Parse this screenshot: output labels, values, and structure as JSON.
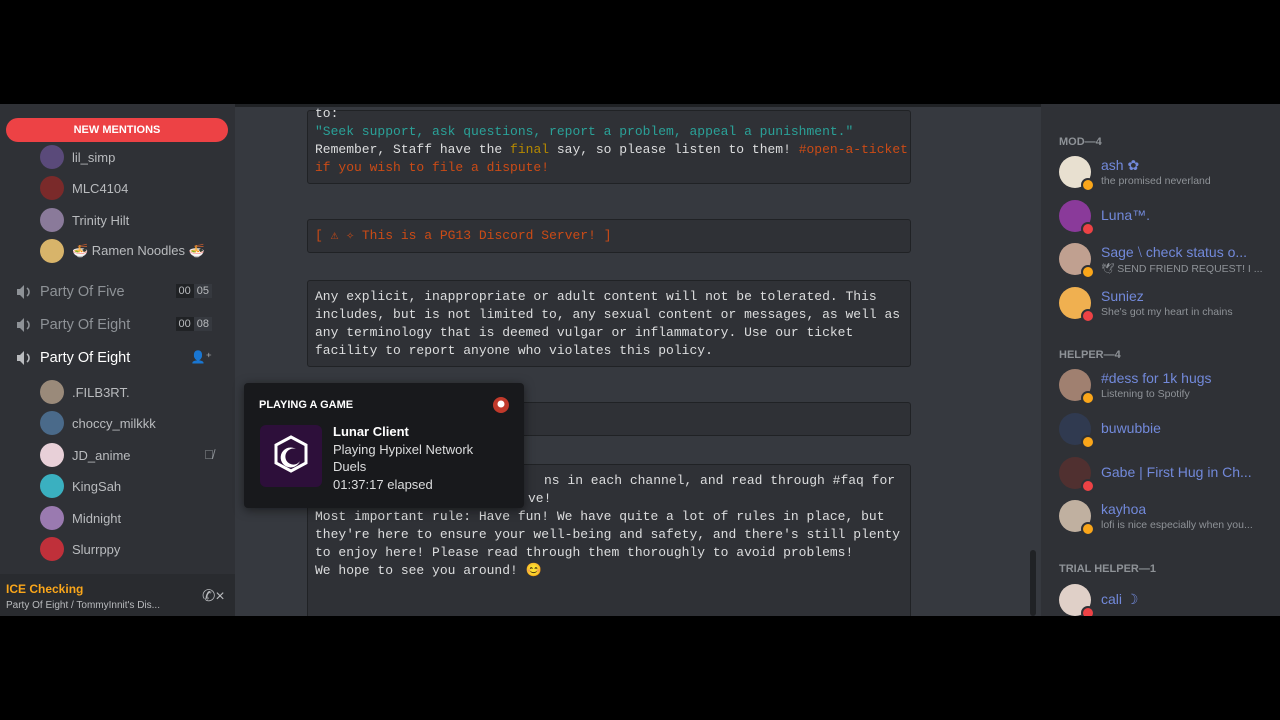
{
  "sidebar": {
    "new_mentions": "NEW MENTIONS",
    "top_users": [
      {
        "name": "lil_simp",
        "color": "#5a4a7a"
      },
      {
        "name": "MLC4104",
        "color": "#7a2a2a"
      },
      {
        "name": "Trinity Hilt",
        "color": "#8a7a9a"
      },
      {
        "name": "🍜 Ramen Noodles 🍜",
        "color": "#d8b46a"
      }
    ],
    "voice_channels": [
      {
        "name": "Party Of Five",
        "time_a": "00",
        "time_b": "05"
      },
      {
        "name": "Party Of Eight",
        "time_a": "00",
        "time_b": "08"
      },
      {
        "name": "Party Of Eight"
      }
    ],
    "channel_users": [
      {
        "name": ".FILB3RT.",
        "color": "#9a8a7a"
      },
      {
        "name": "choccy_milkkk",
        "color": "#4a6a8a"
      },
      {
        "name": "JD_anime",
        "color": "#e8d0d8"
      },
      {
        "name": "KingSah",
        "color": "#3ab0c0"
      },
      {
        "name": "Midnight",
        "color": "#9a7ab0"
      },
      {
        "name": "Slurrppy",
        "color": "#c0303a"
      }
    ],
    "voice_status": {
      "title": "ICE Checking",
      "subtitle": "Party Of Eight / TommyInnit's Dis..."
    }
  },
  "chat": {
    "embed1": {
      "line0": "to:",
      "line1": "\"Seek support, ask questions, report a problem, appeal a punishment.\"",
      "line2_a": "Remember, Staff have the ",
      "line2_b": "final",
      "line2_c": " say, so please listen to them! ",
      "line2_d": "#open-a-ticket",
      "line3": "if you wish to file a dispute!"
    },
    "embed2": "[ ⚠ ✧ This is a PG13 Discord Server! ]",
    "embed3": [
      "Any explicit, inappropriate or adult content will not be tolerated. This",
      "includes, but is not limited to, any sexual content or messages, as well as",
      "any terminology that is deemed vulgar or inflammatory. Use our ticket",
      "facility to report anyone who violates this policy."
    ],
    "embed5": [
      "ns in each channel, and read through #faq for",
      "ve!",
      "",
      "Most important rule: Have fun! We have quite a lot of rules in place, but",
      "they're here to ensure your well-being and safety, and there's still plenty",
      "to enjoy here! Please read through them thoroughly to avoid problems!",
      "",
      "We hope to see you around! 😊"
    ]
  },
  "popout": {
    "header": "PLAYING A GAME",
    "game": "Lunar Client",
    "details": "Playing Hypixel Network",
    "state": "Duels",
    "elapsed": "01:37:17 elapsed"
  },
  "members": {
    "roles": [
      "MOD—4",
      "HELPER—4",
      "TRIAL HELPER—1"
    ],
    "list": [
      {
        "name": "ash ✿",
        "sub": "the promised neverland",
        "avatar": "#e8e0d0",
        "status": "#faa61a"
      },
      {
        "name": "Luna™.",
        "sub": "",
        "avatar": "#8a3a9a",
        "status": "#ed4245"
      },
      {
        "name": "Sage ⧵ check status o...",
        "sub": "🕊 SEND FRIEND REQUEST! I ...",
        "avatar": "#c0a090",
        "status": "#faa61a"
      },
      {
        "name": "Suniez",
        "sub": "She's got my heart in chains",
        "avatar": "#f0b050",
        "status": "#ed4245"
      },
      {
        "name": "#dess for 1k hugs",
        "sub": "Listening to Spotify",
        "avatar": "#a08070",
        "status": "#faa61a"
      },
      {
        "name": "buwubbie",
        "sub": "",
        "avatar": "#303a50",
        "status": "#faa61a"
      },
      {
        "name": "Gabe | First Hug in Ch...",
        "sub": "",
        "avatar": "#503030",
        "status": "#ed4245"
      },
      {
        "name": "kayhoa",
        "sub": "lofi is nice especially when you...",
        "avatar": "#c0b0a0",
        "status": "#faa61a"
      },
      {
        "name": "cali ☽",
        "sub": "",
        "avatar": "#e0d0c8",
        "status": "#ed4245"
      }
    ]
  }
}
